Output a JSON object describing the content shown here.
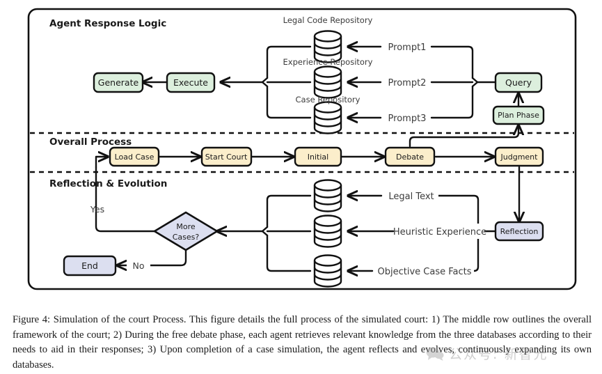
{
  "figure": {
    "sections": [
      {
        "id": "agent-response-logic",
        "title": "Agent Response Logic"
      },
      {
        "id": "overall-process",
        "title": "Overall Process"
      },
      {
        "id": "reflection-evolution",
        "title": "Reflection & Evolution"
      }
    ],
    "top": {
      "repositories": [
        {
          "label": "Legal Code Repository",
          "icon": "database-icon"
        },
        {
          "label": "Experience Repository",
          "icon": "database-icon"
        },
        {
          "label": "Case Repository",
          "icon": "database-icon"
        }
      ],
      "prompts": [
        {
          "label": "Prompt1"
        },
        {
          "label": "Prompt2"
        },
        {
          "label": "Prompt3"
        }
      ],
      "nodes": [
        {
          "id": "generate",
          "label": "Generate",
          "color": "#dcefdd"
        },
        {
          "id": "execute",
          "label": "Execute",
          "color": "#dcefdd"
        },
        {
          "id": "query",
          "label": "Query",
          "color": "#dcefdd"
        },
        {
          "id": "plan-phase",
          "label": "Plan Phase",
          "color": "#dcefdd"
        }
      ]
    },
    "middle": {
      "nodes": [
        {
          "id": "load-case",
          "label": "Load Case",
          "color": "#fbeecb"
        },
        {
          "id": "start-court",
          "label": "Start Court",
          "color": "#fbeecb"
        },
        {
          "id": "initial",
          "label": "Initial",
          "color": "#fbeecb"
        },
        {
          "id": "debate",
          "label": "Debate",
          "color": "#fbeecb"
        },
        {
          "id": "judgment",
          "label": "Judgment",
          "color": "#fbeecb"
        }
      ]
    },
    "bottom": {
      "knowledge": [
        {
          "label": "Legal Text",
          "icon": "database-icon"
        },
        {
          "label": "Heuristic Experience",
          "icon": "database-icon"
        },
        {
          "label": "Objective Case Facts",
          "icon": "database-icon"
        }
      ],
      "nodes": [
        {
          "id": "reflection",
          "label": "Reflection",
          "color": "#dcdff0"
        },
        {
          "id": "more-cases",
          "label_line1": "More",
          "label_line2": "Cases?",
          "color": "#dcdff0"
        },
        {
          "id": "end",
          "label": "End",
          "color": "#dcdff0"
        }
      ],
      "branch_labels": [
        {
          "id": "yes",
          "label": "Yes"
        },
        {
          "id": "no",
          "label": "No"
        }
      ]
    }
  },
  "caption": {
    "text": "Figure 4: Simulation of the court Process. This figure details the full process of the simulated court: 1) The middle row outlines the overall framework of the court; 2) During the free debate phase, each agent retrieves relevant knowledge from the three databases according to their needs to aid in their responses; 3) Upon completion of a case simulation, the agent reflects and evolves, continuously expanding its own databases."
  },
  "watermark": {
    "text": "公众号: 新智元",
    "icon": "speech-bubble-icon"
  }
}
